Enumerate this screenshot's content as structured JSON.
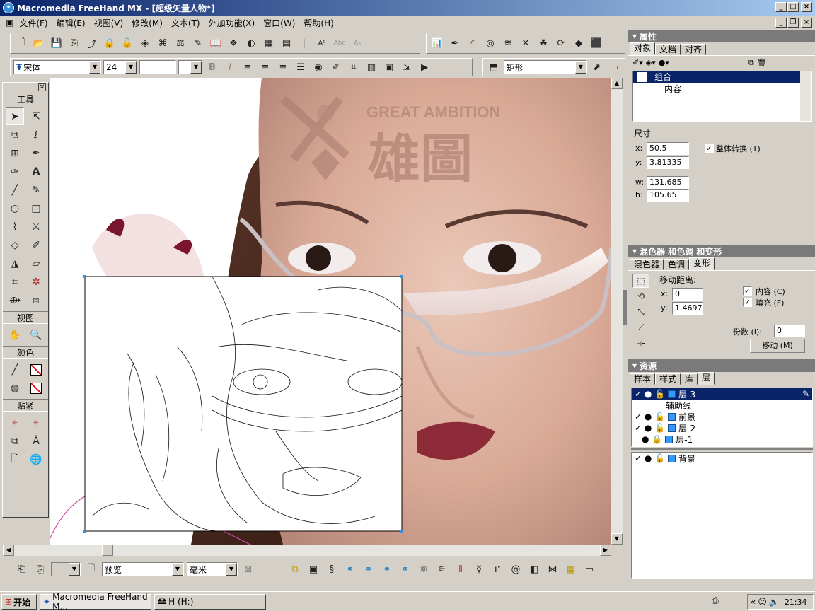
{
  "window": {
    "title": "Macromedia FreeHand MX - [超级矢量人物*]"
  },
  "menu": [
    "文件(F)",
    "编辑(E)",
    "视图(V)",
    "修改(M)",
    "文本(T)",
    "外加功能(X)",
    "窗口(W)",
    "帮助(H)"
  ],
  "text_toolbar": {
    "font": "宋体",
    "size": "24",
    "style_value": "矩形"
  },
  "tools": {
    "header_tools": "工具",
    "header_view": "视图",
    "header_color": "颜色",
    "header_snap": "贴紧"
  },
  "canvas": {
    "logo_en": "GREAT AMBITION",
    "logo_cn": "雄圖"
  },
  "properties": {
    "title": "属性",
    "tabs": [
      "对象",
      "文档",
      "对齐"
    ],
    "tree": [
      "组合",
      "内容"
    ],
    "size_label": "尺寸",
    "x_label": "x:",
    "x": "50.5",
    "y_label": "y:",
    "y": "3.81335",
    "w_label": "w:",
    "w": "131.685",
    "h_label": "h:",
    "h": "105.65",
    "transform_whole": "整体转换 (T)"
  },
  "mixer": {
    "title": "混色器 和色调 和变形",
    "tabs": [
      "混色器",
      "色调",
      "变形"
    ],
    "move_label": "移动距离:",
    "x_label": "x:",
    "x": "0",
    "y_label": "y:",
    "y": "1.46975",
    "content_cb": "内容 (C)",
    "fill_cb": "填充 (F)",
    "copies_label": "份数 (I):",
    "copies": "0",
    "move_button": "移动 (M)"
  },
  "resources": {
    "title": "资源",
    "tabs": [
      "样本",
      "样式",
      "库",
      "层"
    ],
    "layers": [
      "层-3",
      "辅助线",
      "前景",
      "层-2",
      "层-1"
    ],
    "background": "背景"
  },
  "statusbar": {
    "view_mode": "预览",
    "units": "毫米"
  },
  "taskbar": {
    "start": "开始",
    "task1": "Macromedia FreeHand M...",
    "task2": "H (H:)",
    "clock": "21:34"
  }
}
